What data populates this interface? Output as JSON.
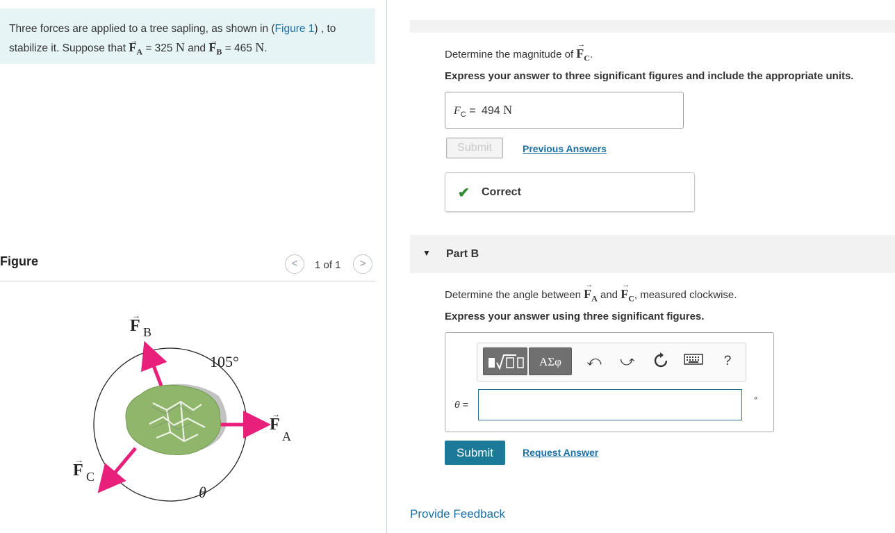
{
  "problem": {
    "text_before": "Three forces are applied to a tree sapling, as shown in (",
    "figure_link": "Figure 1",
    "text_after": ") , to stabilize it. Suppose that",
    "fa_sym": "F",
    "fa_sub": "A",
    "fa_value": "= 325",
    "unit_n": "N",
    "and": "and",
    "fb_sym": "F",
    "fb_sub": "B",
    "fb_value": "= 465",
    "unit_n2": "N",
    "period": "."
  },
  "figure": {
    "title": "Figure",
    "counter": "1 of 1",
    "prev": "<",
    "next": ">",
    "label_fb": "F",
    "label_fb_sub": "B",
    "label_fa": "F",
    "label_fa_sub": "A",
    "label_fc": "F",
    "label_fc_sub": "C",
    "angle_label": "105°",
    "theta_label": "θ",
    "colors": {
      "arrow": "#e8207c",
      "canopy": "#8fb66a",
      "shadow": "#c2c2c2"
    }
  },
  "part_a": {
    "prompt_before": "Determine the magnitude of",
    "prompt_sym": "F",
    "prompt_sub": "C",
    "prompt_after": ".",
    "instruction": "Express your answer to three significant figures and include the appropriate units.",
    "answer_var": "F",
    "answer_var_sub": "C",
    "answer_eq": "=",
    "answer_value": "494",
    "answer_unit": "N",
    "submit_label": "Submit",
    "previous_answers": "Previous Answers",
    "correct_label": "Correct"
  },
  "part_b": {
    "title": "Part B",
    "prompt_before": "Determine the angle between",
    "sym_a": "F",
    "sub_a": "A",
    "and": "and",
    "sym_c": "F",
    "sub_c": "C",
    "prompt_after": ", measured clockwise.",
    "instruction": "Express your answer using three significant figures.",
    "toolbar": {
      "templates_icon": "square-root-template-icon",
      "greek_label": "ΑΣφ",
      "undo_icon": "undo-arrow-icon",
      "redo_icon": "redo-arrow-icon",
      "reset_icon": "reset-icon",
      "keyboard_icon": "keyboard-icon",
      "help_label": "?"
    },
    "theta_label": "θ =",
    "input_value": "",
    "unit": "°",
    "submit_label": "Submit",
    "request_answer": "Request Answer"
  },
  "feedback_link": "Provide Feedback",
  "colors": {
    "accent": "#1c7a99",
    "link": "#1a6fa3",
    "check": "#2e8b2e",
    "problem_bg": "#e6f4f5"
  }
}
